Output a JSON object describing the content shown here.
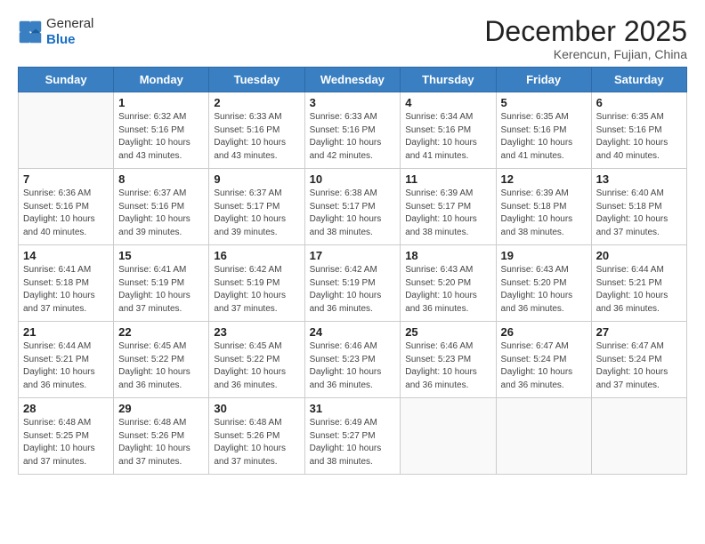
{
  "logo": {
    "general": "General",
    "blue": "Blue"
  },
  "title": "December 2025",
  "subtitle": "Kerencun, Fujian, China",
  "headers": [
    "Sunday",
    "Monday",
    "Tuesday",
    "Wednesday",
    "Thursday",
    "Friday",
    "Saturday"
  ],
  "weeks": [
    [
      {
        "day": "",
        "info": ""
      },
      {
        "day": "1",
        "info": "Sunrise: 6:32 AM\nSunset: 5:16 PM\nDaylight: 10 hours\nand 43 minutes."
      },
      {
        "day": "2",
        "info": "Sunrise: 6:33 AM\nSunset: 5:16 PM\nDaylight: 10 hours\nand 43 minutes."
      },
      {
        "day": "3",
        "info": "Sunrise: 6:33 AM\nSunset: 5:16 PM\nDaylight: 10 hours\nand 42 minutes."
      },
      {
        "day": "4",
        "info": "Sunrise: 6:34 AM\nSunset: 5:16 PM\nDaylight: 10 hours\nand 41 minutes."
      },
      {
        "day": "5",
        "info": "Sunrise: 6:35 AM\nSunset: 5:16 PM\nDaylight: 10 hours\nand 41 minutes."
      },
      {
        "day": "6",
        "info": "Sunrise: 6:35 AM\nSunset: 5:16 PM\nDaylight: 10 hours\nand 40 minutes."
      }
    ],
    [
      {
        "day": "7",
        "info": "Sunrise: 6:36 AM\nSunset: 5:16 PM\nDaylight: 10 hours\nand 40 minutes."
      },
      {
        "day": "8",
        "info": "Sunrise: 6:37 AM\nSunset: 5:16 PM\nDaylight: 10 hours\nand 39 minutes."
      },
      {
        "day": "9",
        "info": "Sunrise: 6:37 AM\nSunset: 5:17 PM\nDaylight: 10 hours\nand 39 minutes."
      },
      {
        "day": "10",
        "info": "Sunrise: 6:38 AM\nSunset: 5:17 PM\nDaylight: 10 hours\nand 38 minutes."
      },
      {
        "day": "11",
        "info": "Sunrise: 6:39 AM\nSunset: 5:17 PM\nDaylight: 10 hours\nand 38 minutes."
      },
      {
        "day": "12",
        "info": "Sunrise: 6:39 AM\nSunset: 5:18 PM\nDaylight: 10 hours\nand 38 minutes."
      },
      {
        "day": "13",
        "info": "Sunrise: 6:40 AM\nSunset: 5:18 PM\nDaylight: 10 hours\nand 37 minutes."
      }
    ],
    [
      {
        "day": "14",
        "info": "Sunrise: 6:41 AM\nSunset: 5:18 PM\nDaylight: 10 hours\nand 37 minutes."
      },
      {
        "day": "15",
        "info": "Sunrise: 6:41 AM\nSunset: 5:19 PM\nDaylight: 10 hours\nand 37 minutes."
      },
      {
        "day": "16",
        "info": "Sunrise: 6:42 AM\nSunset: 5:19 PM\nDaylight: 10 hours\nand 37 minutes."
      },
      {
        "day": "17",
        "info": "Sunrise: 6:42 AM\nSunset: 5:19 PM\nDaylight: 10 hours\nand 36 minutes."
      },
      {
        "day": "18",
        "info": "Sunrise: 6:43 AM\nSunset: 5:20 PM\nDaylight: 10 hours\nand 36 minutes."
      },
      {
        "day": "19",
        "info": "Sunrise: 6:43 AM\nSunset: 5:20 PM\nDaylight: 10 hours\nand 36 minutes."
      },
      {
        "day": "20",
        "info": "Sunrise: 6:44 AM\nSunset: 5:21 PM\nDaylight: 10 hours\nand 36 minutes."
      }
    ],
    [
      {
        "day": "21",
        "info": "Sunrise: 6:44 AM\nSunset: 5:21 PM\nDaylight: 10 hours\nand 36 minutes."
      },
      {
        "day": "22",
        "info": "Sunrise: 6:45 AM\nSunset: 5:22 PM\nDaylight: 10 hours\nand 36 minutes."
      },
      {
        "day": "23",
        "info": "Sunrise: 6:45 AM\nSunset: 5:22 PM\nDaylight: 10 hours\nand 36 minutes."
      },
      {
        "day": "24",
        "info": "Sunrise: 6:46 AM\nSunset: 5:23 PM\nDaylight: 10 hours\nand 36 minutes."
      },
      {
        "day": "25",
        "info": "Sunrise: 6:46 AM\nSunset: 5:23 PM\nDaylight: 10 hours\nand 36 minutes."
      },
      {
        "day": "26",
        "info": "Sunrise: 6:47 AM\nSunset: 5:24 PM\nDaylight: 10 hours\nand 36 minutes."
      },
      {
        "day": "27",
        "info": "Sunrise: 6:47 AM\nSunset: 5:24 PM\nDaylight: 10 hours\nand 37 minutes."
      }
    ],
    [
      {
        "day": "28",
        "info": "Sunrise: 6:48 AM\nSunset: 5:25 PM\nDaylight: 10 hours\nand 37 minutes."
      },
      {
        "day": "29",
        "info": "Sunrise: 6:48 AM\nSunset: 5:26 PM\nDaylight: 10 hours\nand 37 minutes."
      },
      {
        "day": "30",
        "info": "Sunrise: 6:48 AM\nSunset: 5:26 PM\nDaylight: 10 hours\nand 37 minutes."
      },
      {
        "day": "31",
        "info": "Sunrise: 6:49 AM\nSunset: 5:27 PM\nDaylight: 10 hours\nand 38 minutes."
      },
      {
        "day": "",
        "info": ""
      },
      {
        "day": "",
        "info": ""
      },
      {
        "day": "",
        "info": ""
      }
    ]
  ]
}
